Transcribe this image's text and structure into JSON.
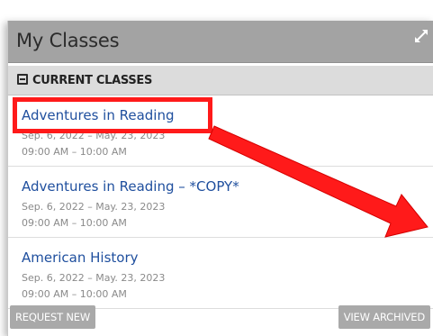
{
  "panel": {
    "title": "My Classes",
    "section_title": "CURRENT CLASSES"
  },
  "classes": [
    {
      "name": "Adventures in Reading",
      "dates": "Sep. 6, 2022 – May. 23, 2023",
      "time": "09:00 AM – 10:00 AM"
    },
    {
      "name": "Adventures in Reading – *COPY*",
      "dates": "Sep. 6, 2022 – May. 23, 2023",
      "time": "09:00 AM – 10:00 AM"
    },
    {
      "name": "American History",
      "dates": "Sep. 6, 2022 – May. 23, 2023",
      "time": "09:00 AM – 10:00 AM"
    }
  ],
  "buttons": {
    "request_new": "REQUEST NEW",
    "view_archived": "VIEW ARCHIVED"
  },
  "icons": {
    "expand": "expand-arrows-icon",
    "collapse": "minus-square-icon"
  },
  "colors": {
    "header_bg": "#a3a3a3",
    "section_bg": "#dcdcdc",
    "link": "#1f4f9e",
    "button_bg": "#a9a9a9",
    "annotation": "#ff1a1a"
  }
}
